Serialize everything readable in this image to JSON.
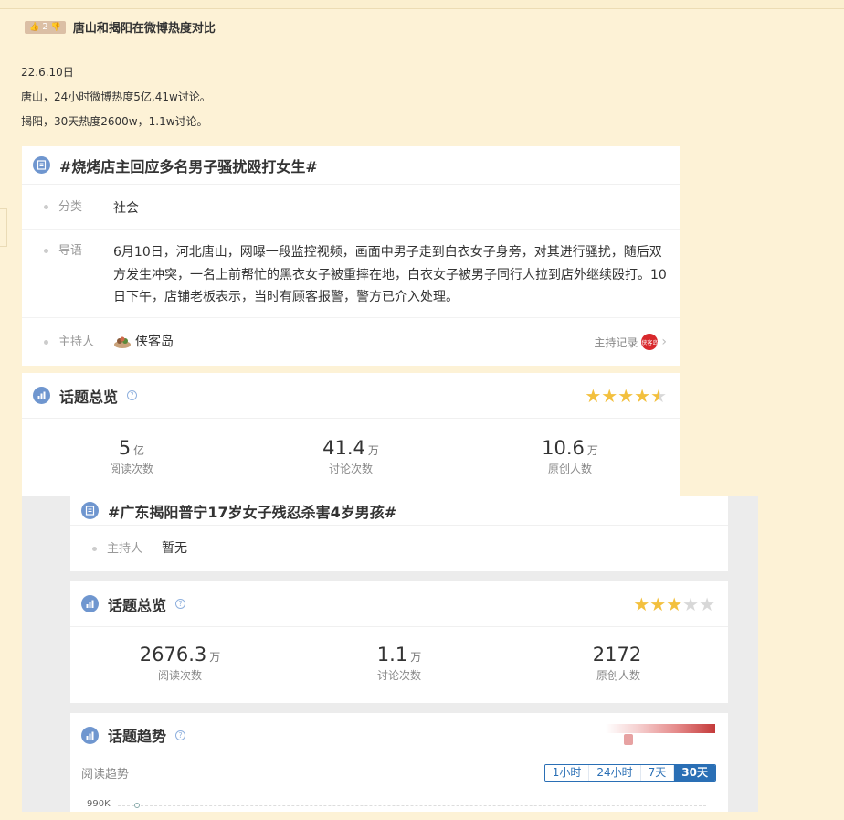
{
  "post": {
    "vote_count": "2",
    "title": "唐山和揭阳在微博热度对比",
    "lines": [
      "22.6.10日",
      "唐山，24小时微博热度5亿,41w讨论。",
      "揭阳，30天热度2600w，1.1w讨论。"
    ]
  },
  "topic1": {
    "title": "#烧烤店主回应多名男子骚扰殴打女生#",
    "category_label": "分类",
    "category_value": "社会",
    "intro_label": "导语",
    "intro_text": "6月10日，河北唐山，网曝一段监控视频，画面中男子走到白衣女子身旁，对其进行骚扰，随后双方发生冲突，一名上前帮忙的黑衣女子被重摔在地，白衣女子被男子同行人拉到店外继续殴打。10日下午，店铺老板表示，当时有顾客报警，警方已介入处理。",
    "host_label": "主持人",
    "host_name": "侠客岛",
    "host_record": "主持记录",
    "host_badge": "侠客岛"
  },
  "overview1": {
    "title": "话题总览",
    "rating": 4.5,
    "stats": [
      {
        "num": "5",
        "unit": "亿",
        "name": "阅读次数"
      },
      {
        "num": "41.4",
        "unit": "万",
        "name": "讨论次数"
      },
      {
        "num": "10.6",
        "unit": "万",
        "name": "原创人数"
      }
    ]
  },
  "topic2": {
    "title": "#广东揭阳普宁17岁女子残忍杀害4岁男孩#",
    "host_label": "主持人",
    "host_name": "暂无"
  },
  "overview2": {
    "title": "话题总览",
    "rating": 3,
    "stats": [
      {
        "num": "2676.3",
        "unit": "万",
        "name": "阅读次数"
      },
      {
        "num": "1.1",
        "unit": "万",
        "name": "讨论次数"
      },
      {
        "num": "2172",
        "unit": "",
        "name": "原创人数"
      }
    ]
  },
  "trend": {
    "title": "话题趋势",
    "subtitle": "阅读趋势",
    "ranges": [
      "1小时",
      "24小时",
      "7天",
      "30天"
    ],
    "active_range": "30天",
    "y_tick": "990K"
  },
  "colors": {
    "page_bg": "#fdf2d6",
    "accent_blue": "#2a6fb5",
    "icon_blue": "#6f96cf",
    "star_on": "#f3c03e",
    "star_off": "#d8d8d8",
    "badge_red": "#d8282c"
  }
}
